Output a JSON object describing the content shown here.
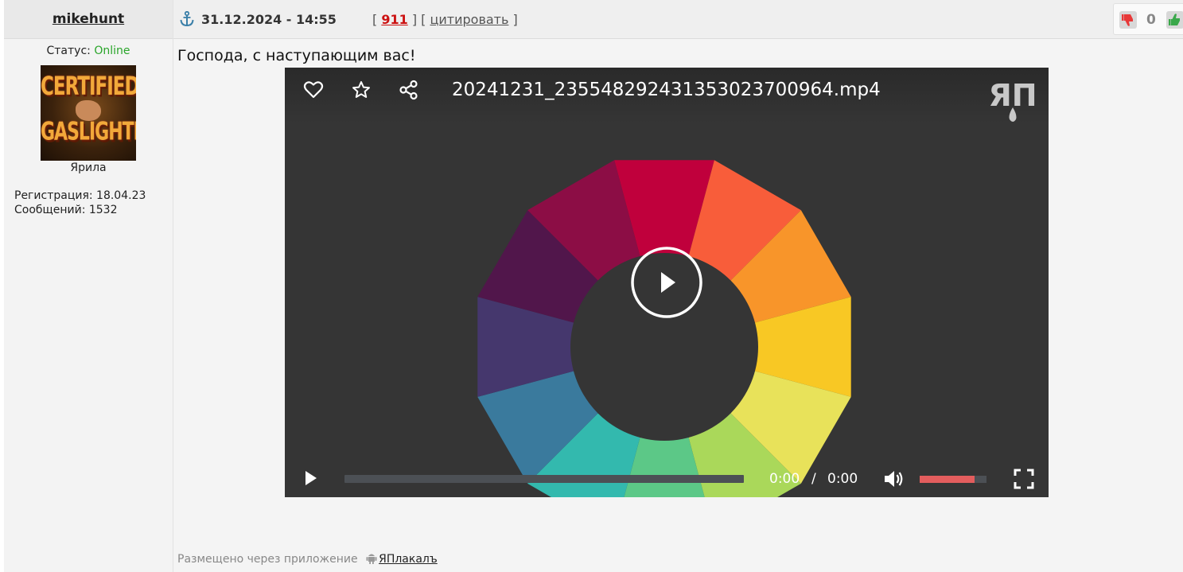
{
  "author": {
    "username": "mikehunt",
    "status_label": "Статус:",
    "status_value": "Online",
    "avatar_line1": "CERTIFIED",
    "avatar_line2": "GASLIGHTER",
    "rank": "Ярила",
    "registration": "Регистрация: 18.04.23",
    "messages": "Сообщений: 1532"
  },
  "post": {
    "datetime": "31.12.2024 - 14:55",
    "number": "911",
    "quote_label": "цитировать",
    "rating": "0",
    "text": "Господа, с наступающим вас!",
    "footer_prefix": "Размещено через приложение",
    "footer_app": "ЯПлакалъ"
  },
  "player": {
    "filename": "20241231_235548292431353023700964.mp4",
    "logo_text": "ЯП",
    "current_time": "0:00",
    "separator": "/",
    "duration": "0:00",
    "volume_level": 0.82,
    "progress": 0,
    "icons": [
      "heart-icon",
      "star-icon",
      "share-icon",
      "play-icon",
      "volume-icon",
      "fullscreen-icon"
    ]
  },
  "colors": {
    "online": "#2aa52a",
    "post_number": "#cc1111",
    "player_bg": "#353535",
    "volume_fill": "#e35d5d",
    "wheel": [
      "#c0003c",
      "#f85d3a",
      "#f8952a",
      "#f8c824",
      "#e8e25a",
      "#aad85a",
      "#5cc887",
      "#33b9ae",
      "#3a7a9d",
      "#45376d",
      "#51164b",
      "#8c0d45"
    ]
  }
}
